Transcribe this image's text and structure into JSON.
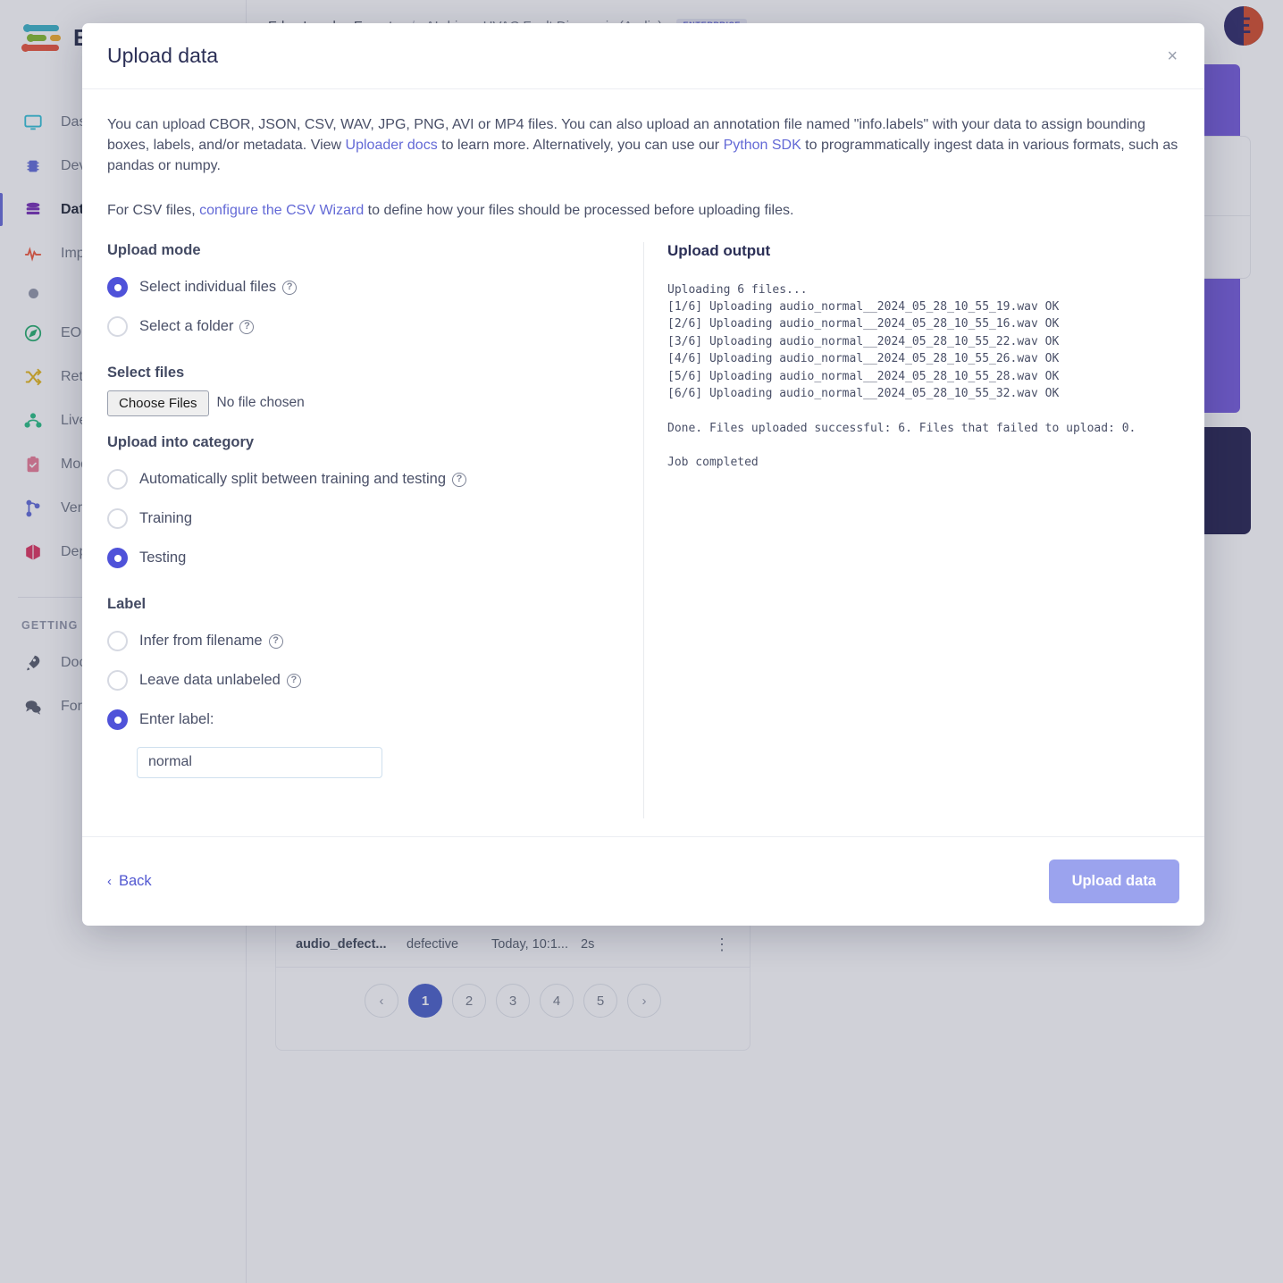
{
  "app": {
    "logo_text": "Edge Impulse",
    "breadcrumb": {
      "org": "Edge Impulse Experts",
      "separator": "/",
      "project": "AI-driven HVAC Fault Diagnosis (Audio)",
      "badge": "ENTERPRISE"
    },
    "avatar_initial": "E"
  },
  "sidebar": {
    "items": [
      {
        "label": "Dashboard",
        "icon": "monitor-icon",
        "color": "#22bcd4"
      },
      {
        "label": "Devices",
        "icon": "chip-icon",
        "color": "#5561d6"
      },
      {
        "label": "Data acquisition",
        "icon": "database-icon",
        "color": "#6c1fb0"
      },
      {
        "label": "Impulse design",
        "icon": "pulse-icon",
        "color": "#ef4b2c"
      }
    ],
    "sub_item": {
      "label": "",
      "icon": "dot-icon"
    },
    "items_2": [
      {
        "label": "EON Tuner",
        "icon": "compass-icon",
        "color": "#13a862"
      },
      {
        "label": "Retrain model",
        "icon": "shuffle-icon",
        "color": "#e2b007"
      },
      {
        "label": "Live classification",
        "icon": "graph-icon",
        "color": "#17b97a"
      },
      {
        "label": "Model testing",
        "icon": "clipboard-check-icon",
        "color": "#e8728e"
      },
      {
        "label": "Versioning",
        "icon": "branch-icon",
        "color": "#5561d6"
      },
      {
        "label": "Deployment",
        "icon": "box-icon",
        "color": "#dc2453"
      }
    ],
    "section_label": "GETTING STARTED",
    "items_3": [
      {
        "label": "Documentation",
        "icon": "rocket-icon",
        "color": "#4b5160"
      },
      {
        "label": "Forums",
        "icon": "chat-icon",
        "color": "#4b5160"
      }
    ]
  },
  "background": {
    "sample_row": {
      "filename": "audio_defect...",
      "label": "defective",
      "time": "Today, 10:1...",
      "duration": "2s",
      "menu_icon": "kebab-menu-icon"
    },
    "pagination": {
      "prev": "‹",
      "pages": [
        "1",
        "2",
        "3",
        "4",
        "5"
      ],
      "active": "1",
      "next": "›"
    },
    "usb_icon": "usb-icon"
  },
  "modal": {
    "title": "Upload data",
    "close_icon": "close-icon",
    "intro_1_a": "You can upload CBOR, JSON, CSV, WAV, JPG, PNG, AVI or MP4 files. You can also upload an annotation file named \"info.labels\" with your data to assign bounding boxes, labels, and/or metadata. View ",
    "intro_1_link1": "Uploader docs",
    "intro_1_b": " to learn more. Alternatively, you can use our ",
    "intro_1_link2": "Python SDK",
    "intro_1_c": " to programmatically ingest data in various formats, such as pandas or numpy.",
    "intro_2_a": "For CSV files, ",
    "intro_2_link": "configure the CSV Wizard",
    "intro_2_b": " to define how your files should be processed before uploading files.",
    "upload_mode": {
      "title": "Upload mode",
      "options": [
        {
          "label": "Select individual files",
          "selected": true,
          "help": true
        },
        {
          "label": "Select a folder",
          "selected": false,
          "help": true
        }
      ]
    },
    "select_files": {
      "title": "Select files",
      "button_label": "Choose Files",
      "status": "No file chosen"
    },
    "category": {
      "title": "Upload into category",
      "options": [
        {
          "label": "Automatically split between training and testing",
          "selected": false,
          "help": true
        },
        {
          "label": "Training",
          "selected": false,
          "help": false
        },
        {
          "label": "Testing",
          "selected": true,
          "help": false
        }
      ]
    },
    "label_section": {
      "title": "Label",
      "options": [
        {
          "label": "Infer from filename",
          "selected": false,
          "help": true
        },
        {
          "label": "Leave data unlabeled",
          "selected": false,
          "help": true
        },
        {
          "label": "Enter label:",
          "selected": true,
          "help": false
        }
      ],
      "input_value": "normal",
      "input_placeholder": ""
    },
    "output": {
      "title": "Upload output",
      "lines": "Uploading 6 files...\n[1/6] Uploading audio_normal__2024_05_28_10_55_19.wav OK\n[2/6] Uploading audio_normal__2024_05_28_10_55_16.wav OK\n[3/6] Uploading audio_normal__2024_05_28_10_55_22.wav OK\n[4/6] Uploading audio_normal__2024_05_28_10_55_26.wav OK\n[5/6] Uploading audio_normal__2024_05_28_10_55_28.wav OK\n[6/6] Uploading audio_normal__2024_05_28_10_55_32.wav OK\n\nDone. Files uploaded successful: 6. Files that failed to upload: 0.",
      "status_line": "Job completed",
      "status_color": "#3cb878"
    },
    "footer": {
      "back_label": "Back",
      "back_chevron": "‹",
      "upload_label": "Upload data"
    }
  },
  "colors": {
    "accent": "#4f52d9",
    "link": "#6369d6",
    "button_primary": "#9ba3ee",
    "success": "#3cb878",
    "purple_panel": "#6b4fd8",
    "dark_card": "#151243"
  }
}
